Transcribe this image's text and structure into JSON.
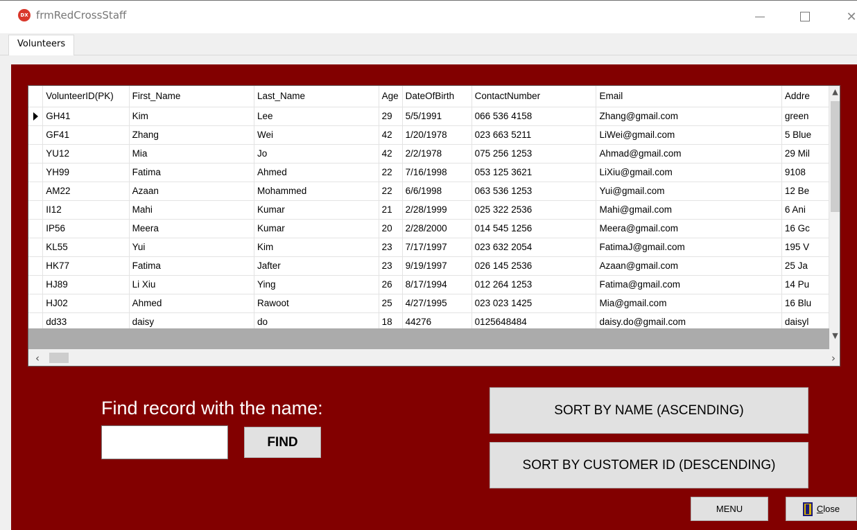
{
  "window": {
    "title": "frmRedCrossStaff",
    "app_icon_text": "DX",
    "close_glyph": "✕"
  },
  "tabs": [
    {
      "label": "Volunteers",
      "active": true
    }
  ],
  "grid": {
    "columns": [
      "VolunteerID(PK)",
      "First_Name",
      "Last_Name",
      "Age",
      "DateOfBirth",
      "ContactNumber",
      "Email",
      "Addre"
    ],
    "rows": [
      [
        "GH41",
        "Kim",
        "Lee",
        "29",
        "5/5/1991",
        "066 536 4158",
        "Zhang@gmail.com",
        "green"
      ],
      [
        "GF41",
        "Zhang",
        "Wei",
        "42",
        "1/20/1978",
        "023 663 5211",
        "LiWei@gmail.com",
        "5 Blue"
      ],
      [
        "YU12",
        "Mia",
        "Jo",
        "42",
        "2/2/1978",
        "075 256 1253",
        "Ahmad@gmail.com",
        "29 Mil"
      ],
      [
        "YH99",
        "Fatima",
        "Ahmed",
        "22",
        "7/16/1998",
        "053 125 3621",
        "LiXiu@gmail.com",
        "9108"
      ],
      [
        "AM22",
        "Azaan",
        "Mohammed",
        "22",
        "6/6/1998",
        "063 536 1253",
        "Yui@gmail.com",
        "12 Be"
      ],
      [
        "II12",
        "Mahi",
        "Kumar",
        "21",
        "2/28/1999",
        "025 322 2536",
        "Mahi@gmail.com",
        "6 Ani"
      ],
      [
        "IP56",
        "Meera",
        "Kumar",
        "20",
        "2/28/2000",
        "014 545 1256",
        "Meera@gmail.com",
        "16 Gc"
      ],
      [
        "KL55",
        "Yui",
        "Kim",
        "23",
        "7/17/1997",
        "023 632 2054",
        "FatimaJ@gmail.com",
        "195 V"
      ],
      [
        "HK77",
        "Fatima",
        "Jafter",
        "23",
        "9/19/1997",
        "026 145 2536",
        "Azaan@gmail.com",
        "25 Ja"
      ],
      [
        "HJ89",
        "Li Xiu",
        "Ying",
        "26",
        "8/17/1994",
        "012 264 1253",
        "Fatima@gmail.com",
        "14 Pu"
      ],
      [
        "HJ02",
        "Ahmed",
        "Rawoot",
        "25",
        "4/27/1995",
        "023 023 1425",
        "Mia@gmail.com",
        "16 Blu"
      ],
      [
        "dd33",
        "daisy",
        "do",
        "18",
        "44276",
        "0125648484",
        "daisy.do@gmail.com",
        "daisyl"
      ]
    ],
    "selected_row": 0
  },
  "search": {
    "label": "Find record with the name:",
    "value": "",
    "button": "FIND"
  },
  "sort": {
    "by_name": "SORT BY NAME (ASCENDING)",
    "by_id": "SORT BY CUSTOMER ID (DESCENDING)"
  },
  "footer": {
    "menu": "MENU",
    "close": "Close",
    "close_mnemonic": "C",
    "close_rest": "lose"
  },
  "colors": {
    "panel": "#820000",
    "button": "#e1e1e1"
  },
  "icons": [
    "app-logo-icon",
    "minimize-icon",
    "maximize-icon",
    "close-icon",
    "row-selector-icon",
    "scroll-up-icon",
    "scroll-down-icon",
    "scroll-left-icon",
    "scroll-right-icon",
    "exit-door-icon"
  ]
}
